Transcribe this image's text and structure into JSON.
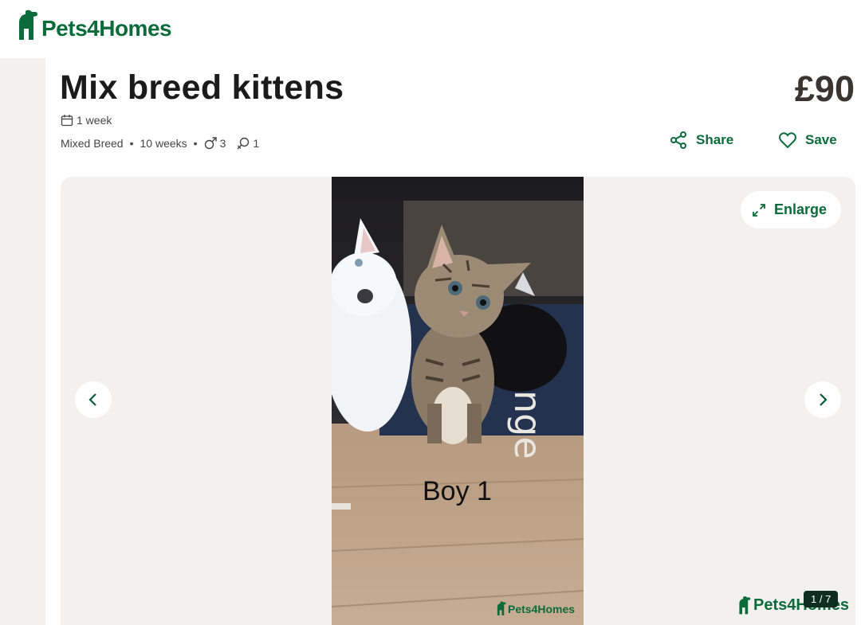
{
  "brand": {
    "name": "Pets4Homes",
    "color": "#0b6b3a"
  },
  "listing": {
    "title": "Mix breed kittens",
    "price": "£90",
    "posted": "1 week",
    "breed": "Mixed Breed",
    "age": "10 weeks",
    "male_count": "3",
    "female_count": "1"
  },
  "actions": {
    "share_label": "Share",
    "save_label": "Save"
  },
  "gallery": {
    "enlarge_label": "Enlarge",
    "counter": "1 / 7",
    "caption": "Boy 1",
    "watermark": "Pets4Homes",
    "photo_watermark": "Pets4Homes"
  },
  "icons": [
    "calendar-icon",
    "male-icon",
    "female-icon",
    "share-icon",
    "heart-icon",
    "expand-icon",
    "chevron-left-icon",
    "chevron-right-icon"
  ]
}
